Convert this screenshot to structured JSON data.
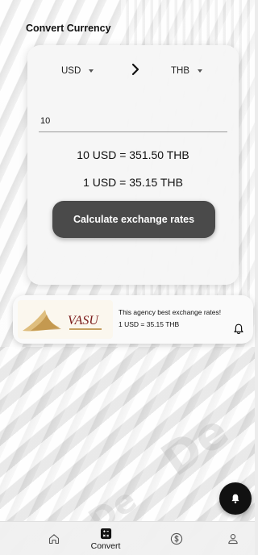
{
  "page": {
    "title": "Convert Currency"
  },
  "converter": {
    "from_currency": "USD",
    "to_currency": "THB",
    "amount": "10",
    "result_line": "10 USD = 351.50 THB",
    "rate_line": "1 USD = 35.15 THB",
    "calculate_label": "Calculate exchange rates"
  },
  "agency": {
    "logo_text": "VASU",
    "headline": "This agency best exchange rates!",
    "rate": "1 USD = 35.15 THB"
  },
  "nav": {
    "items": [
      {
        "icon": "home-icon",
        "label": ""
      },
      {
        "icon": "calculator-icon",
        "label": "Convert",
        "active": true
      },
      {
        "icon": "dollar-icon",
        "label": ""
      },
      {
        "icon": "profile-icon",
        "label": ""
      }
    ]
  },
  "colors": {
    "button": "#4a4a4a",
    "fab": "#111111",
    "card": "#f6f6f6"
  }
}
